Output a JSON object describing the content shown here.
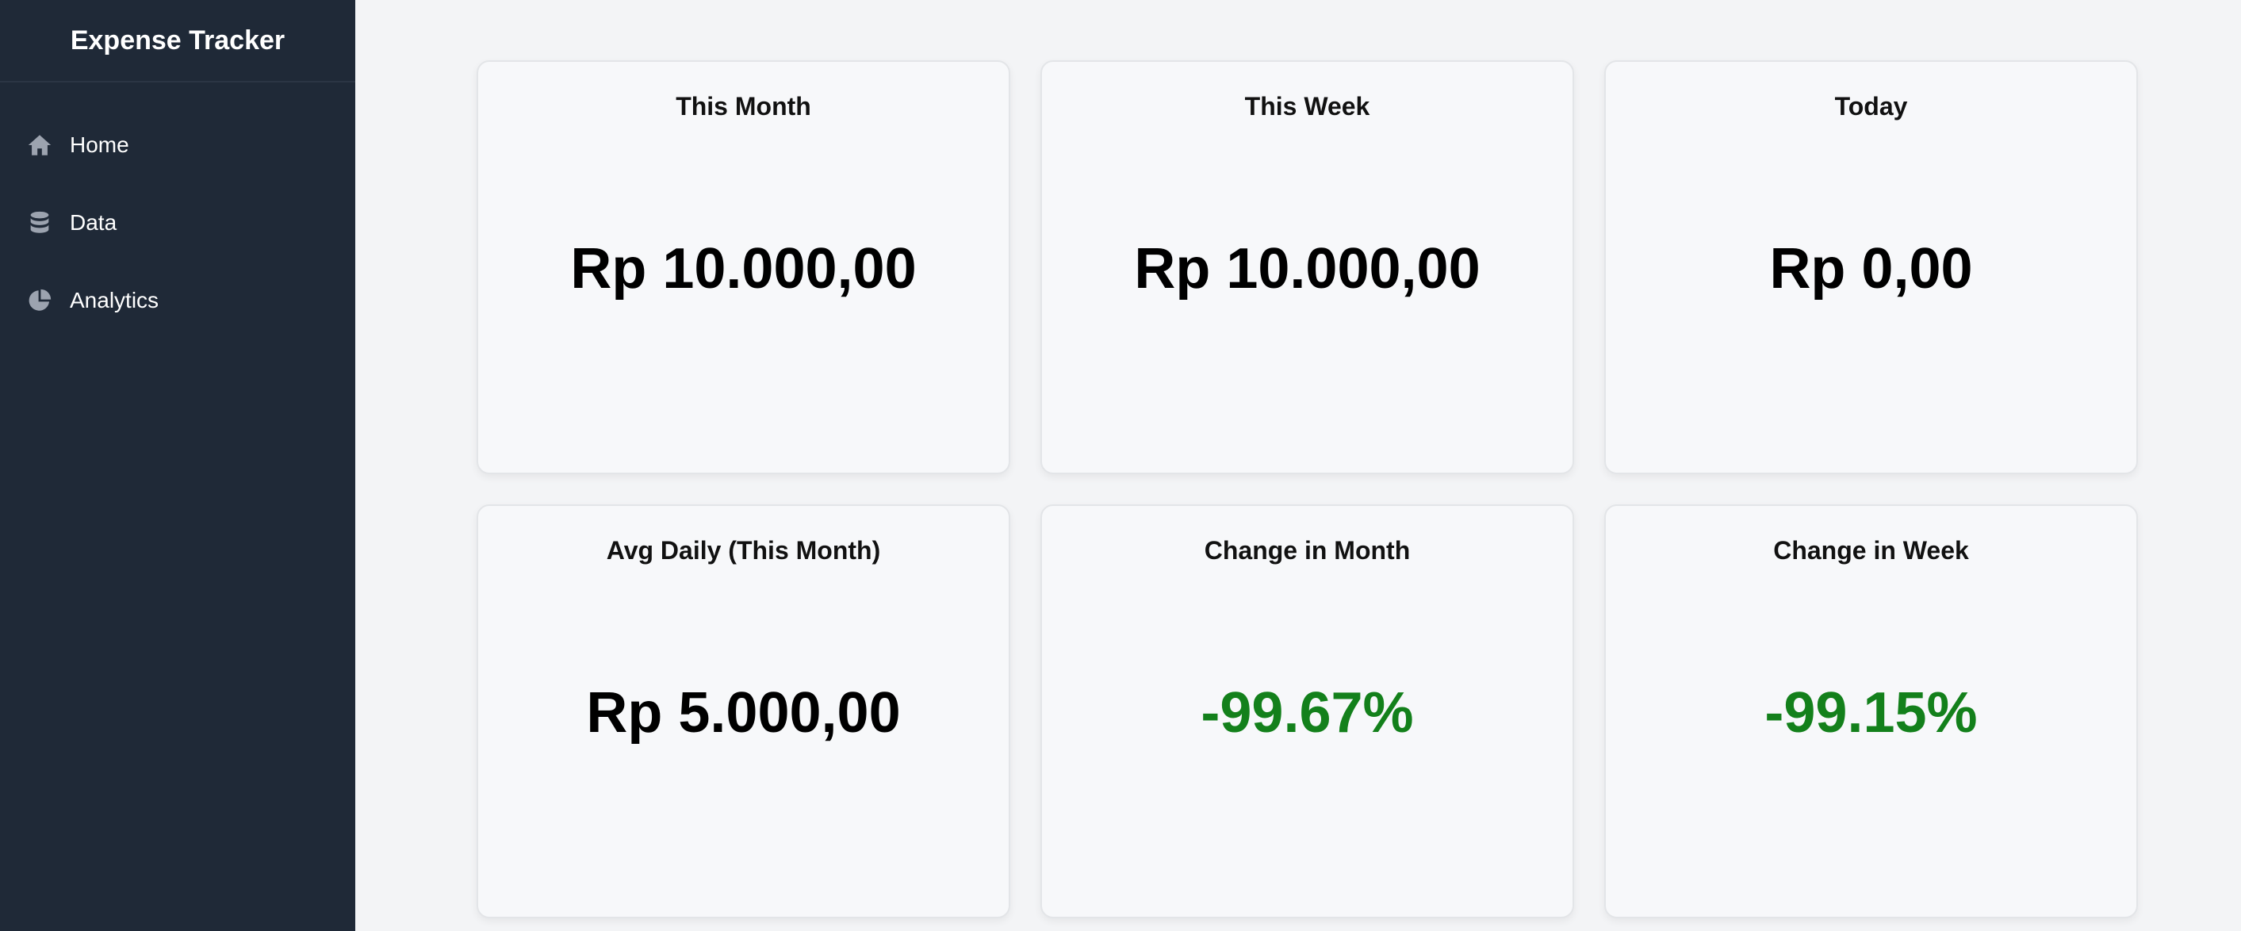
{
  "sidebar": {
    "title": "Expense Tracker",
    "items": [
      {
        "label": "Home",
        "icon": "home-icon"
      },
      {
        "label": "Data",
        "icon": "database-icon"
      },
      {
        "label": "Analytics",
        "icon": "pie-chart-icon"
      }
    ]
  },
  "colors": {
    "sidebar_bg": "#1f2937",
    "page_bg": "#f3f4f6",
    "card_bg": "#f7f8fa",
    "change_green": "#13801b"
  },
  "cards": [
    {
      "title": "This Month",
      "value": "Rp 10.000,00"
    },
    {
      "title": "This Week",
      "value": "Rp 10.000,00"
    },
    {
      "title": "Today",
      "value": "Rp 0,00"
    },
    {
      "title": "Avg Daily (This Month)",
      "value": "Rp 5.000,00"
    },
    {
      "title": "Change in Month",
      "value": "-99.67%"
    },
    {
      "title": "Change in Week",
      "value": "-99.15%"
    }
  ]
}
